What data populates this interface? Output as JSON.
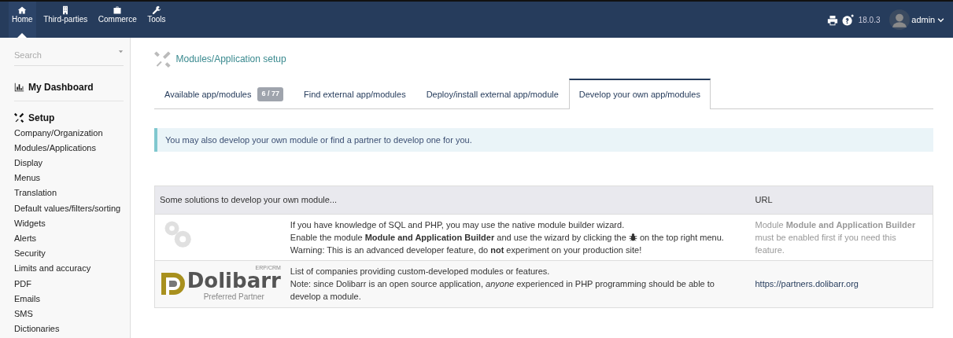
{
  "top_menu": [
    {
      "label": "Home",
      "selected": true
    },
    {
      "label": "Third-parties",
      "selected": false
    },
    {
      "label": "Commerce",
      "selected": false
    },
    {
      "label": "Tools",
      "selected": false
    }
  ],
  "top_right": {
    "version": "18.0.3",
    "user": "admin"
  },
  "sidebar": {
    "search": {
      "placeholder": "Search"
    },
    "sections": [
      {
        "title": "My Dashboard"
      },
      {
        "title": "Setup",
        "items": [
          "Company/Organization",
          "Modules/Applications",
          "Display",
          "Menus",
          "Translation",
          "Default values/filters/sorting",
          "Widgets",
          "Alerts",
          "Security",
          "Limits and accuracy",
          "PDF",
          "Emails",
          "SMS",
          "Dictionaries"
        ]
      }
    ]
  },
  "page_title": "Modules/Application setup",
  "tabs": [
    {
      "label": "Available app/modules",
      "badge": "6 / 77",
      "selected": false
    },
    {
      "label": "Find external app/modules",
      "selected": false
    },
    {
      "label": "Deploy/install external app/module",
      "selected": false
    },
    {
      "label": "Develop your own app/modules",
      "selected": true
    }
  ],
  "info": "You may also develop your own module or find a partner to develop one for you.",
  "table": {
    "columns": [
      "Some solutions to develop your own module...",
      "URL"
    ],
    "rows": [
      {
        "kind": "builder",
        "lines": [
          {
            "text": "If you have knowledge of SQL and PHP, you may use the native module builder wizard."
          },
          {
            "text": "Enable the module **Module and Application Builder** and use the wizard by clicking the",
            "after_icon": "on the top right menu."
          },
          {
            "text": "Warning: This is an advanced developer feature, do **not** experiment on your production site!"
          }
        ],
        "url": "Module **Module and Application Builder** must be enabled first if you need this feature."
      },
      {
        "kind": "partner",
        "logo": {
          "name": "Dolibarr",
          "tag": "ERP/CRM",
          "sub": "Preferred Partner"
        },
        "lines": [
          {
            "text": "List of companies providing custom-developed modules or features."
          },
          {
            "text": "Note: since Dolibarr is an open source application, *anyone* experienced in PHP programming should be able to develop a module."
          }
        ],
        "url": "https://partners.dolibarr.org"
      }
    ]
  }
}
